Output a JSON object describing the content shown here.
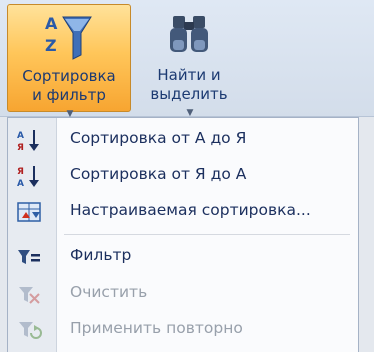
{
  "ribbon": {
    "sort_filter": {
      "line1": "Сортировка",
      "line2": "и фильтр"
    },
    "find_select": {
      "line1": "Найти и",
      "line2": "выделить"
    }
  },
  "menu": {
    "items": [
      {
        "label": "Сортировка от А до Я",
        "icon": "sort-ascending-icon"
      },
      {
        "label": "Сортировка от Я до А",
        "icon": "sort-descending-icon"
      },
      {
        "label": "Настраиваемая сортировка...",
        "icon": "custom-sort-icon"
      },
      {
        "label": "Фильтр",
        "icon": "filter-icon"
      },
      {
        "label": "Очистить",
        "icon": "clear-filter-icon",
        "disabled": true
      },
      {
        "label": "Применить повторно",
        "icon": "reapply-filter-icon",
        "disabled": true
      }
    ]
  },
  "colors": {
    "accent_orange": "#f7a531",
    "ribbon_blue": "#dfe8f4",
    "menu_text": "#1b2f5e",
    "disabled_text": "#98a0ab"
  }
}
